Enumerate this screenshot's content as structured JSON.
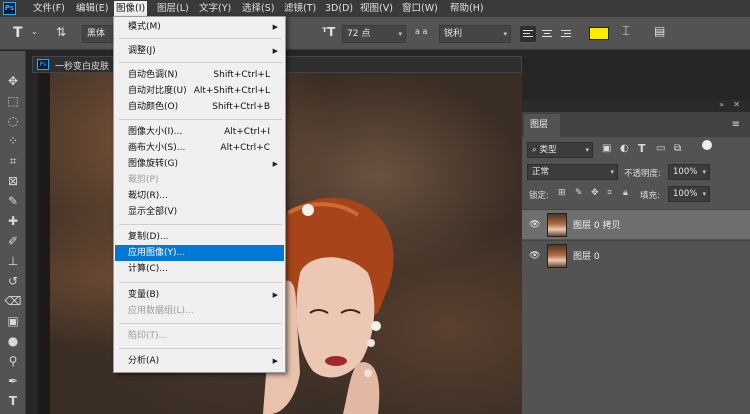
{
  "app": {
    "logo_text": "Ps"
  },
  "menubar": {
    "items": [
      {
        "label": "文件(F)"
      },
      {
        "label": "编辑(E)"
      },
      {
        "label": "图像(I)"
      },
      {
        "label": "图层(L)"
      },
      {
        "label": "文字(Y)"
      },
      {
        "label": "选择(S)"
      },
      {
        "label": "滤镜(T)"
      },
      {
        "label": "3D(D)"
      },
      {
        "label": "视图(V)"
      },
      {
        "label": "窗口(W)"
      },
      {
        "label": "帮助(H)"
      }
    ]
  },
  "options_bar": {
    "font_family": "黑体",
    "font_size": "72 点",
    "aa_label": "a a",
    "antialias": "锐利",
    "text_color": "#ffeb00"
  },
  "document": {
    "title": "一秒变白皮肤",
    "logo_text": "Ps"
  },
  "image_menu": {
    "items": [
      {
        "label": "模式(M)",
        "shortcut": "",
        "submenu": true,
        "disabled": false
      },
      {
        "label": "调整(J)",
        "shortcut": "",
        "submenu": true,
        "disabled": false
      },
      {
        "label": "自动色调(N)",
        "shortcut": "Shift+Ctrl+L",
        "submenu": false,
        "disabled": false
      },
      {
        "label": "自动对比度(U)",
        "shortcut": "Alt+Shift+Ctrl+L",
        "submenu": false,
        "disabled": false
      },
      {
        "label": "自动颜色(O)",
        "shortcut": "Shift+Ctrl+B",
        "submenu": false,
        "disabled": false
      },
      {
        "label": "图像大小(I)...",
        "shortcut": "Alt+Ctrl+I",
        "submenu": false,
        "disabled": false
      },
      {
        "label": "画布大小(S)...",
        "shortcut": "Alt+Ctrl+C",
        "submenu": false,
        "disabled": false
      },
      {
        "label": "图像旋转(G)",
        "shortcut": "",
        "submenu": true,
        "disabled": false
      },
      {
        "label": "裁剪(P)",
        "shortcut": "",
        "submenu": false,
        "disabled": true
      },
      {
        "label": "裁切(R)...",
        "shortcut": "",
        "submenu": false,
        "disabled": false
      },
      {
        "label": "显示全部(V)",
        "shortcut": "",
        "submenu": false,
        "disabled": false
      },
      {
        "label": "复制(D)...",
        "shortcut": "",
        "submenu": false,
        "disabled": false
      },
      {
        "label": "应用图像(Y)...",
        "shortcut": "",
        "submenu": false,
        "disabled": false,
        "highlighted": true
      },
      {
        "label": "计算(C)...",
        "shortcut": "",
        "submenu": false,
        "disabled": false
      },
      {
        "label": "变量(B)",
        "shortcut": "",
        "submenu": true,
        "disabled": false
      },
      {
        "label": "应用数据组(L)...",
        "shortcut": "",
        "submenu": false,
        "disabled": true
      },
      {
        "label": "陷印(T)...",
        "shortcut": "",
        "submenu": false,
        "disabled": true
      },
      {
        "label": "分析(A)",
        "shortcut": "",
        "submenu": true,
        "disabled": false
      }
    ]
  },
  "layers_panel": {
    "tab_label": "图层",
    "filter_kind": "类型",
    "blend_mode": "正常",
    "opacity_label": "不透明度:",
    "opacity_value": "100%",
    "lock_label": "锁定:",
    "fill_label": "填充:",
    "fill_value": "100%",
    "layers": [
      {
        "name": "图层 0 拷贝",
        "selected": true
      },
      {
        "name": "图层 0",
        "selected": false
      }
    ]
  }
}
